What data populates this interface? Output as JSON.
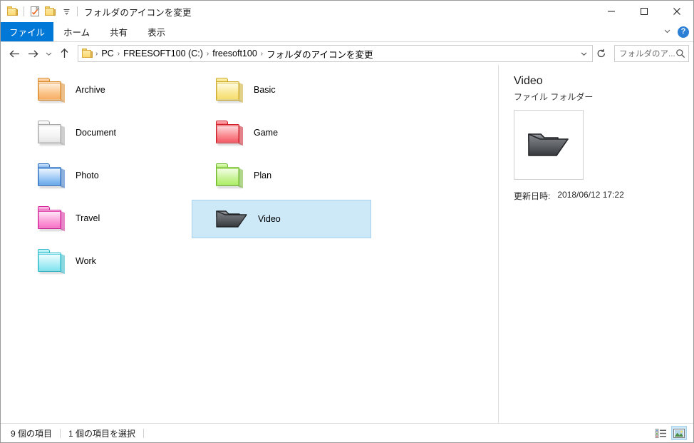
{
  "window": {
    "title": "フォルダのアイコンを変更",
    "quick_access": [
      {
        "name": "folder-icon",
        "label": "フォルダー"
      },
      {
        "name": "properties-icon",
        "label": "プロパティ"
      },
      {
        "name": "new-folder-icon",
        "label": "新しいフォルダー"
      },
      {
        "name": "chevron-down-icon",
        "label": "▾"
      }
    ],
    "controls": {
      "minimize": "─",
      "maximize": "□",
      "close": "✕"
    }
  },
  "ribbon": {
    "tabs": [
      {
        "label": "ファイル",
        "active": true
      },
      {
        "label": "ホーム",
        "active": false
      },
      {
        "label": "共有",
        "active": false
      },
      {
        "label": "表示",
        "active": false
      }
    ],
    "expand_label": "∨",
    "help_label": "?"
  },
  "address": {
    "back_label": "←",
    "forward_label": "→",
    "recent_label": "∨",
    "up_label": "↑",
    "crumbs": [
      "PC",
      "FREESOFT100 (C:)",
      "freesoft100",
      "フォルダのアイコンを変更"
    ],
    "separator": "›",
    "dropdown_label": "∨",
    "refresh_label": "↻"
  },
  "search": {
    "placeholder": "フォルダのア...",
    "value": ""
  },
  "files": {
    "items": [
      {
        "name": "Archive",
        "icon": "folder-orange",
        "color": "#f9b46a",
        "color_dark": "#d98a2b",
        "color_light": "#fde0c0",
        "selected": false,
        "col": 0,
        "row": 0
      },
      {
        "name": "Document",
        "icon": "folder-white",
        "color": "#e9e9e9",
        "color_dark": "#a8a8a8",
        "color_light": "#ffffff",
        "selected": false,
        "col": 0,
        "row": 1
      },
      {
        "name": "Photo",
        "icon": "folder-blue",
        "color": "#7eb6ef",
        "color_dark": "#2f6fc0",
        "color_light": "#cfe3fb",
        "selected": false,
        "col": 0,
        "row": 2
      },
      {
        "name": "Travel",
        "icon": "folder-pink",
        "color": "#f87dc8",
        "color_dark": "#d4249b",
        "color_light": "#ffc8e9",
        "selected": false,
        "col": 0,
        "row": 3
      },
      {
        "name": "Work",
        "icon": "folder-cyan",
        "color": "#8de6ef",
        "color_dark": "#2bb8c9",
        "color_light": "#d5f7fb",
        "selected": false,
        "col": 0,
        "row": 4
      },
      {
        "name": "Basic",
        "icon": "folder-yellow",
        "color": "#f7df70",
        "color_dark": "#ccab2a",
        "color_light": "#fdf3bd",
        "selected": false,
        "col": 1,
        "row": 0
      },
      {
        "name": "Game",
        "icon": "folder-red",
        "color": "#f4626a",
        "color_dark": "#cc1d28",
        "color_light": "#ffb6ba",
        "selected": false,
        "col": 1,
        "row": 1
      },
      {
        "name": "Plan",
        "icon": "folder-green",
        "color": "#b0ef6a",
        "color_dark": "#6fb62b",
        "color_light": "#e2fbc2",
        "selected": false,
        "col": 1,
        "row": 2
      },
      {
        "name": "Video",
        "icon": "folder-dark-open",
        "color": "#6f7174",
        "color_dark": "#2b2d30",
        "color_light": "#b9bcbf",
        "selected": true,
        "col": 1,
        "row": 3
      }
    ]
  },
  "details": {
    "title": "Video",
    "type": "ファイル フォルダー",
    "modified_label": "更新日時:",
    "modified_value": "2018/06/12 17:22"
  },
  "status": {
    "count_text": "9 個の項目",
    "selection_text": "1 個の項目を選択",
    "views": [
      {
        "name": "details-view-button",
        "active": false
      },
      {
        "name": "large-icons-view-button",
        "active": true
      }
    ]
  }
}
